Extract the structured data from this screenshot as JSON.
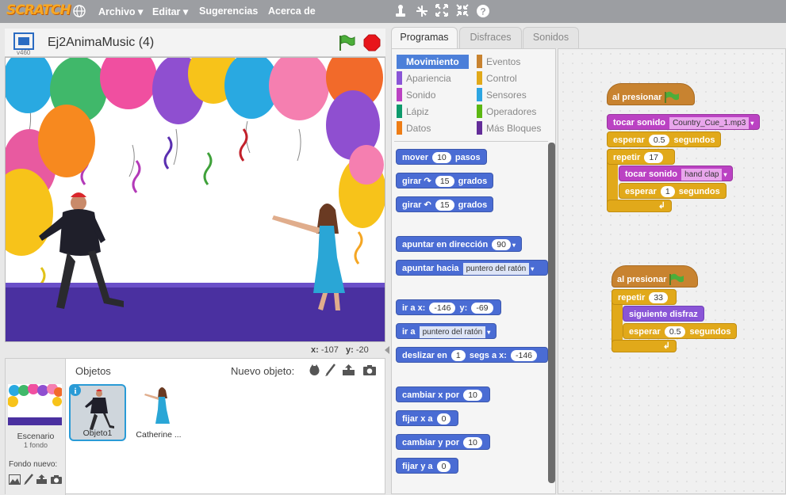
{
  "menu": {
    "logo": "SCRATCH",
    "items": [
      "Archivo",
      "Editar",
      "Sugerencias",
      "Acerca de"
    ]
  },
  "stage": {
    "title": "Ej2AnimaMusic (4)",
    "version": "v460",
    "coords": {
      "x_label": "x:",
      "x": "-107",
      "y_label": "y:",
      "y": "-20"
    }
  },
  "sprites": {
    "objetos_label": "Objetos",
    "nuevo_label": "Nuevo objeto:",
    "stage_label": "Escenario",
    "stage_backdrops": "1 fondo",
    "new_backdrop_label": "Fondo nuevo:",
    "items": [
      {
        "name": "Objeto1"
      },
      {
        "name": "Catherine ..."
      }
    ]
  },
  "tabs": [
    "Programas",
    "Disfraces",
    "Sonidos"
  ],
  "categories": {
    "left": [
      "Movimiento",
      "Apariencia",
      "Sonido",
      "Lápiz",
      "Datos"
    ],
    "right": [
      "Eventos",
      "Control",
      "Sensores",
      "Operadores",
      "Más Bloques"
    ]
  },
  "colors": {
    "motion": "#4a6cd4",
    "looks": "#8a55d7",
    "sound": "#bb42c3",
    "pen": "#0e9a6c",
    "data": "#ee7d16",
    "events": "#c88330",
    "control": "#e1a91a",
    "sensing": "#2ca5e2",
    "operators": "#5cb712",
    "more": "#632d99"
  },
  "palette_blocks": {
    "b1": {
      "t1": "mover",
      "n1": "10",
      "t2": "pasos"
    },
    "b2": {
      "t1": "girar",
      "n1": "15",
      "t2": "grados"
    },
    "b3": {
      "t1": "girar",
      "n1": "15",
      "t2": "grados"
    },
    "b4": {
      "t1": "apuntar en dirección",
      "n1": "90"
    },
    "b5": {
      "t1": "apuntar hacia",
      "d1": "puntero del ratón"
    },
    "b6": {
      "t1": "ir a x:",
      "n1": "-146",
      "t2": "y:",
      "n2": "-69"
    },
    "b7": {
      "t1": "ir a",
      "d1": "puntero del ratón"
    },
    "b8": {
      "t1": "deslizar en",
      "n1": "1",
      "t2": "segs a x:",
      "n2": "-146"
    },
    "b9": {
      "t1": "cambiar x por",
      "n1": "10"
    },
    "b10": {
      "t1": "fijar x a",
      "n1": "0"
    },
    "b11": {
      "t1": "cambiar y por",
      "n1": "10"
    },
    "b12": {
      "t1": "fijar y a",
      "n1": "0"
    }
  },
  "script1": {
    "hat": "al presionar",
    "play": "tocar sonido",
    "sound": "Country_Cue_1.mp3",
    "wait1": "esperar",
    "wait1_val": "0.5",
    "wait1_unit": "segundos",
    "repeat": "repetir",
    "repeat_val": "17",
    "inner_play": "tocar sonido",
    "inner_sound": "hand clap",
    "inner_wait": "esperar",
    "inner_wait_val": "1",
    "inner_wait_unit": "segundos"
  },
  "script2": {
    "hat": "al presionar",
    "repeat": "repetir",
    "repeat_val": "33",
    "next": "siguiente disfraz",
    "wait": "esperar",
    "wait_val": "0.5",
    "wait_unit": "segundos"
  }
}
